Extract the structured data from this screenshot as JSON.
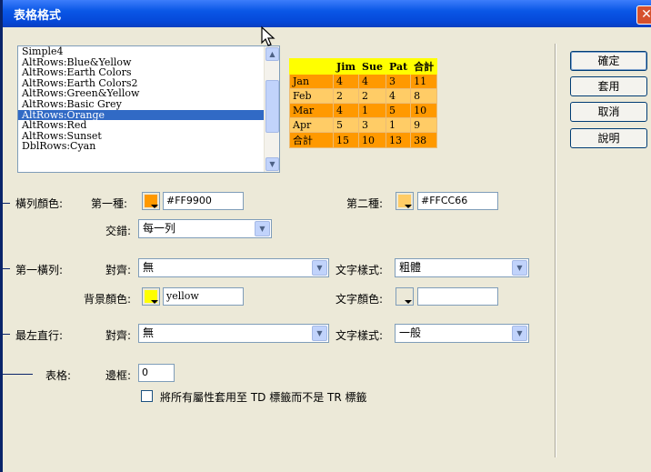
{
  "window": {
    "title": "表格格式",
    "close_glyph": "✕"
  },
  "format_list": {
    "items": [
      "Simple4",
      "AltRows:Blue&Yellow",
      "AltRows:Earth Colors",
      "AltRows:Earth Colors2",
      "AltRows:Green&Yellow",
      "AltRows:Basic Grey",
      "AltRows:Orange",
      "AltRows:Red",
      "AltRows:Sunset",
      "DblRows:Cyan"
    ],
    "selected": "AltRows:Orange"
  },
  "preview_table": {
    "header": [
      "",
      "Jim",
      "Sue",
      "Pat",
      "合計"
    ],
    "rows": [
      [
        "Jan",
        "4",
        "4",
        "3",
        "11"
      ],
      [
        "Feb",
        "2",
        "2",
        "4",
        "8"
      ],
      [
        "Mar",
        "4",
        "1",
        "5",
        "10"
      ],
      [
        "Apr",
        "5",
        "3",
        "1",
        "9"
      ],
      [
        "合計",
        "15",
        "10",
        "13",
        "38"
      ]
    ],
    "colors": {
      "header": "#ffff00",
      "row_a": "#ff9900",
      "row_b": "#ffcc66"
    }
  },
  "buttons": {
    "ok": "確定",
    "apply": "套用",
    "cancel": "取消",
    "help": "說明"
  },
  "row_colors": {
    "label": "橫列顏色:",
    "first_label": "第一種:",
    "first_value": "#FF9900",
    "first_color": "#ff9900",
    "second_label": "第二種:",
    "second_value": "#FFCC66",
    "second_color": "#ffcc66",
    "alternate_label": "交錯:",
    "alternate_value": "每一列"
  },
  "first_row": {
    "label": "第一橫列:",
    "align_label": "對齊:",
    "align_value": "無",
    "text_style_label": "文字樣式:",
    "text_style_value": "粗體",
    "bg_color_label": "背景顏色:",
    "bg_color_value": "yellow",
    "bg_color": "#ffff00",
    "text_color_label": "文字顏色:",
    "text_color_value": ""
  },
  "left_column": {
    "label": "最左直行:",
    "align_label": "對齊:",
    "align_value": "無",
    "text_style_label": "文字樣式:",
    "text_style_value": "一般"
  },
  "table": {
    "label": "表格:",
    "border_label": "邊框:",
    "border_value": "0",
    "apply_td_label": "將所有屬性套用至 TD 標籤而不是 TR 標籤",
    "apply_td_checked": false
  }
}
